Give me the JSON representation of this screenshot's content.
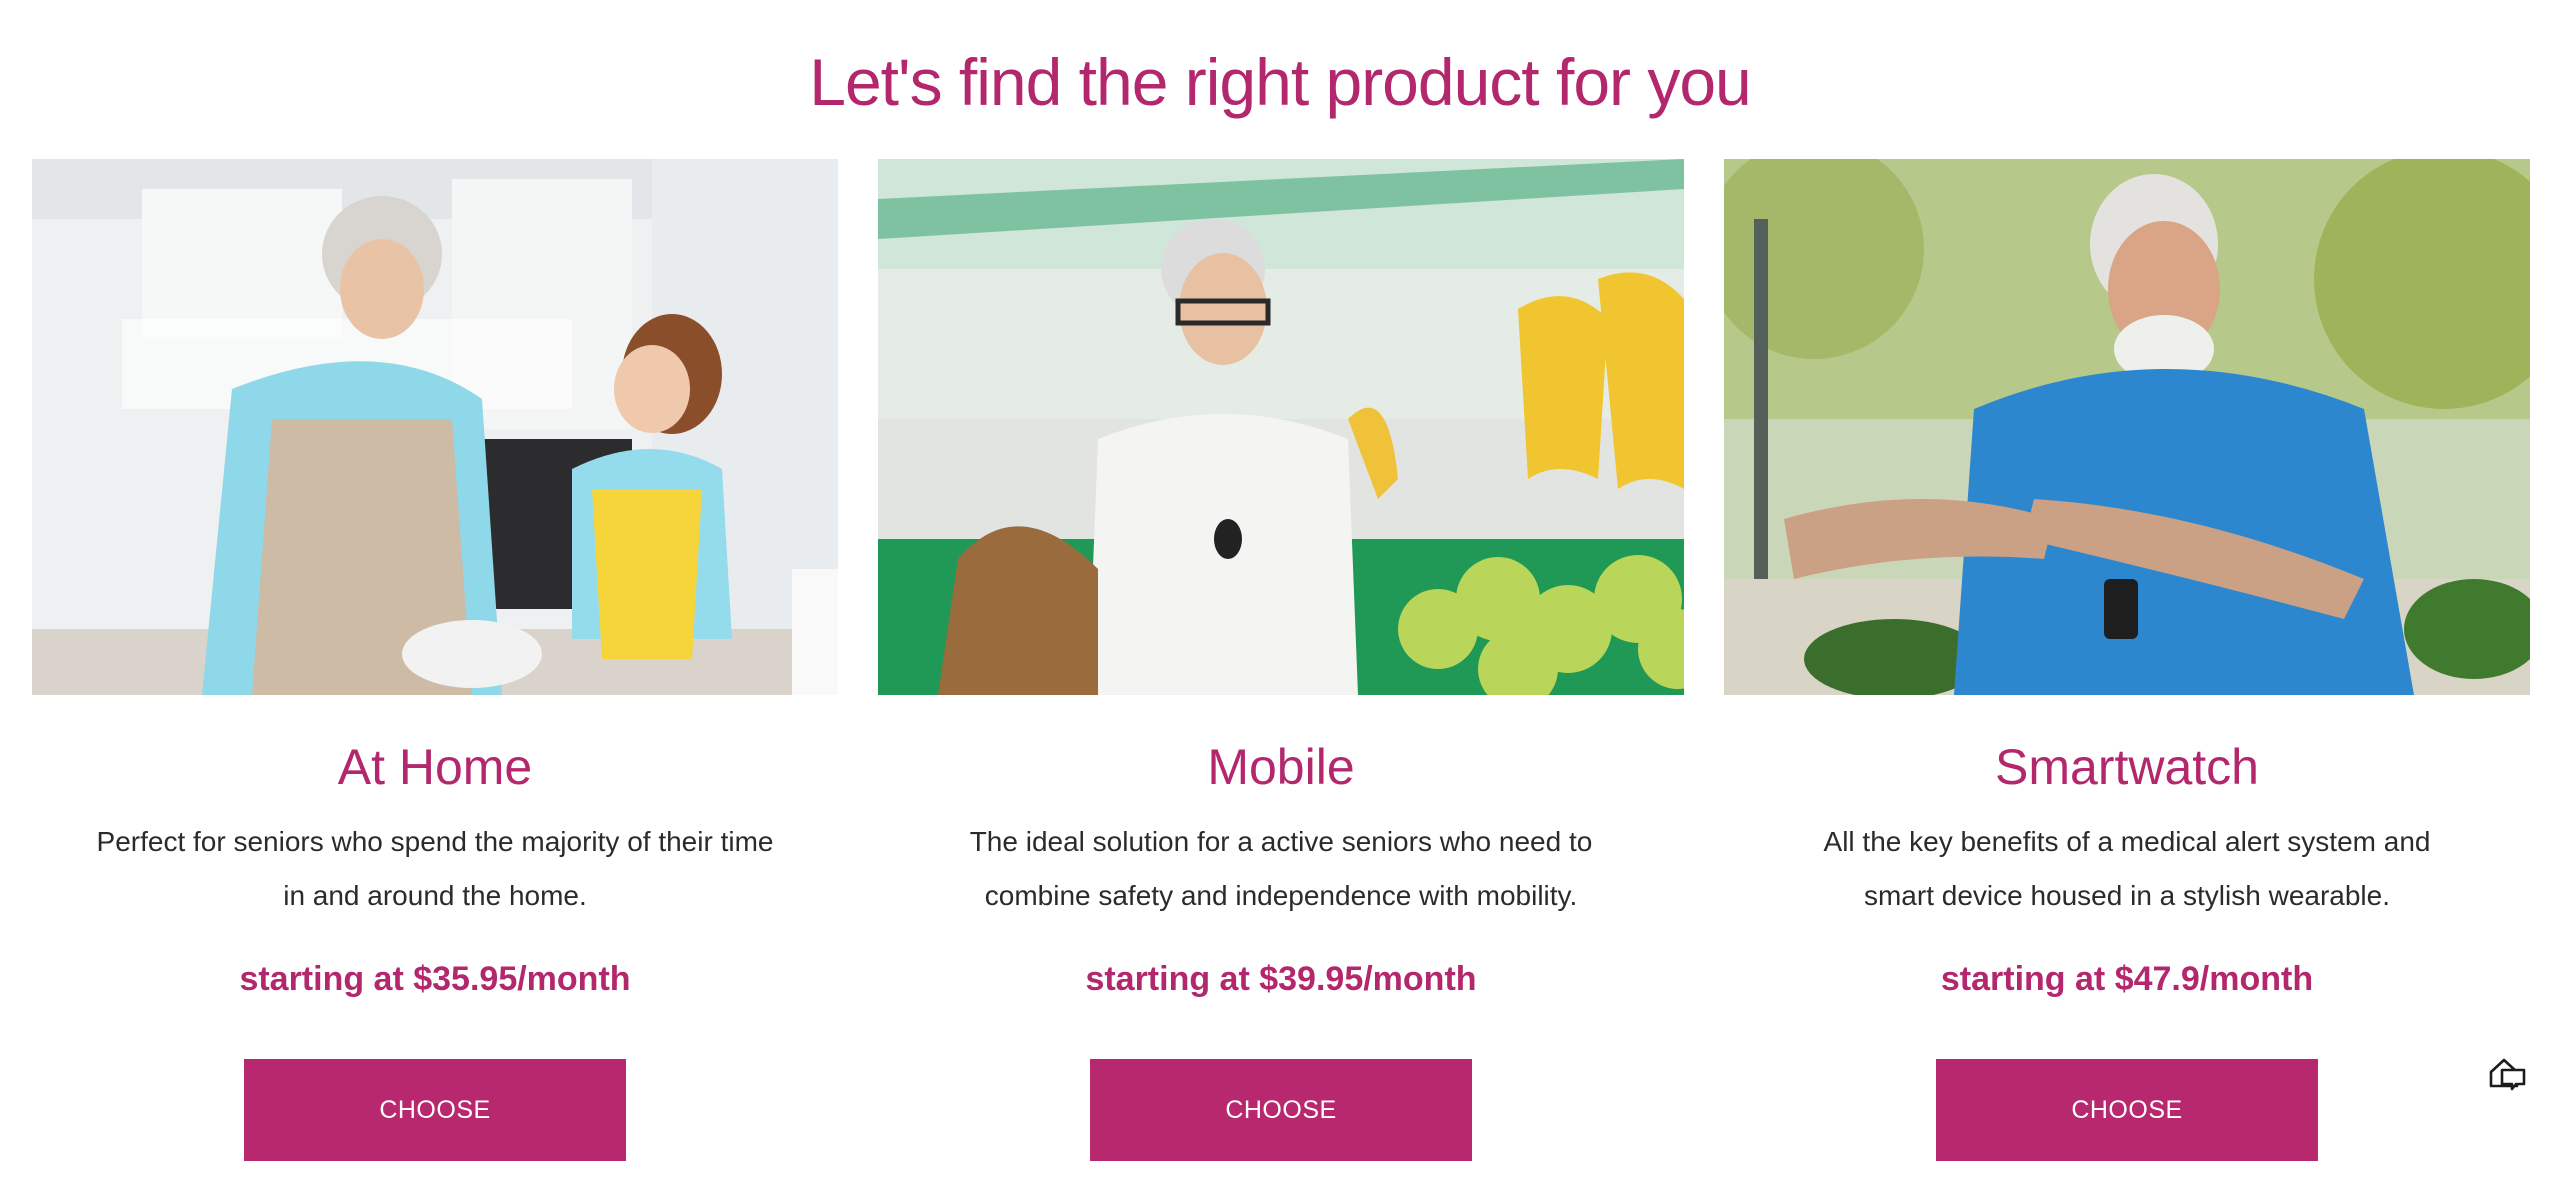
{
  "page": {
    "title": "Let's find the right product for you"
  },
  "colors": {
    "accent": "#b3276d",
    "button": "#b8286f",
    "text": "#2b2b2b"
  },
  "products": [
    {
      "title": "At Home",
      "description": "Perfect for seniors who spend the majority of their time in and around the home.",
      "price": "starting at $35.95/month",
      "button_label": "CHOOSE",
      "image_alt": "Grandmother baking with granddaughter in kitchen"
    },
    {
      "title": "Mobile",
      "description": "The ideal solution for a active seniors who need to combine safety and independence with mobility.",
      "price": "starting at $39.95/month",
      "button_label": "CHOOSE",
      "image_alt": "Senior woman shopping for bananas at market"
    },
    {
      "title": "Smartwatch",
      "description": "All the key benefits of a medical alert system and smart device housed in a stylish wearable.",
      "price": "starting at $47.9/month",
      "button_label": "CHOOSE",
      "image_alt": "Senior man pointing at his smartwatch outdoors"
    }
  ],
  "widgets": {
    "corner_icon": "home-chat-icon"
  }
}
